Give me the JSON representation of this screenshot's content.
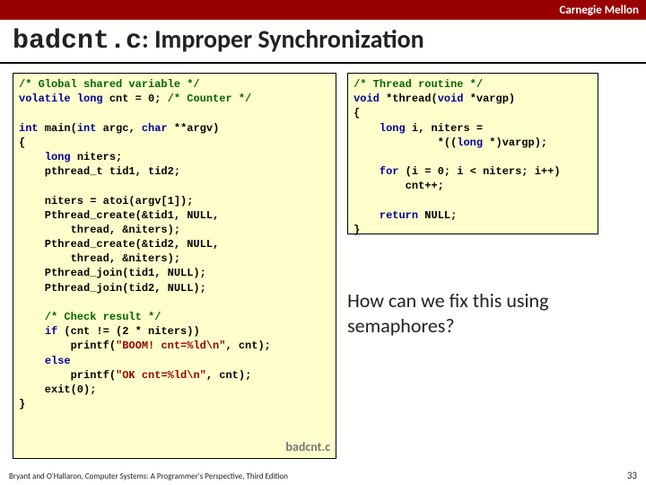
{
  "header": {
    "institution": "Carnegie Mellon"
  },
  "title": {
    "code_part": "badcnt.c",
    "text_part": ": Improper Synchronization"
  },
  "left_code": {
    "c1": "/* Global shared variable */",
    "l2a": "volatile",
    "l2b": "long",
    "l2c": " cnt = 0; ",
    "l2d": "/* Counter */",
    "l4a": "int",
    "l4b": " main(",
    "l4c": "int",
    "l4d": " argc, ",
    "l4e": "char",
    "l4f": " **argv)",
    "l5": "{",
    "l6a": "    ",
    "l6b": "long",
    "l6c": " niters;",
    "l7": "    pthread_t tid1, tid2;",
    "l9": "    niters = atoi(argv[1]);",
    "l10": "    Pthread_create(&tid1, NULL,",
    "l11": "        thread, &niters);",
    "l12": "    Pthread_create(&tid2, NULL,",
    "l13": "        thread, &niters);",
    "l14": "    Pthread_join(tid1, NULL);",
    "l15": "    Pthread_join(tid2, NULL);",
    "c17": "    /* Check result */",
    "l18a": "    ",
    "l18b": "if",
    "l18c": " (cnt != (2 * niters))",
    "l19a": "        printf(",
    "l19b": "\"BOOM! cnt=%ld\\n\"",
    "l19c": ", cnt);",
    "l20a": "    ",
    "l20b": "else",
    "l21a": "        printf(",
    "l21b": "\"OK cnt=%ld\\n\"",
    "l21c": ", cnt);",
    "l22": "    exit(0);",
    "l23": "}",
    "label": "badcnt.c"
  },
  "right_code": {
    "c1": "/* Thread routine */",
    "l2a": "void",
    "l2b": " *thread(",
    "l2c": "void",
    "l2d": " *vargp)",
    "l3": "{",
    "l4a": "    ",
    "l4b": "long",
    "l4c": " i, niters =",
    "l5a": "             *((",
    "l5b": "long",
    "l5c": " *)vargp);",
    "l7a": "    ",
    "l7b": "for",
    "l7c": " (i = 0; i < niters; i++)",
    "l8": "        cnt++;",
    "l10a": "    ",
    "l10b": "return",
    "l10c": " NULL;",
    "l11": "}"
  },
  "question": "How can we fix this using semaphores?",
  "footer": "Bryant and O'Hallaron, Computer Systems: A Programmer's Perspective, Third Edition",
  "pagenum": "33"
}
